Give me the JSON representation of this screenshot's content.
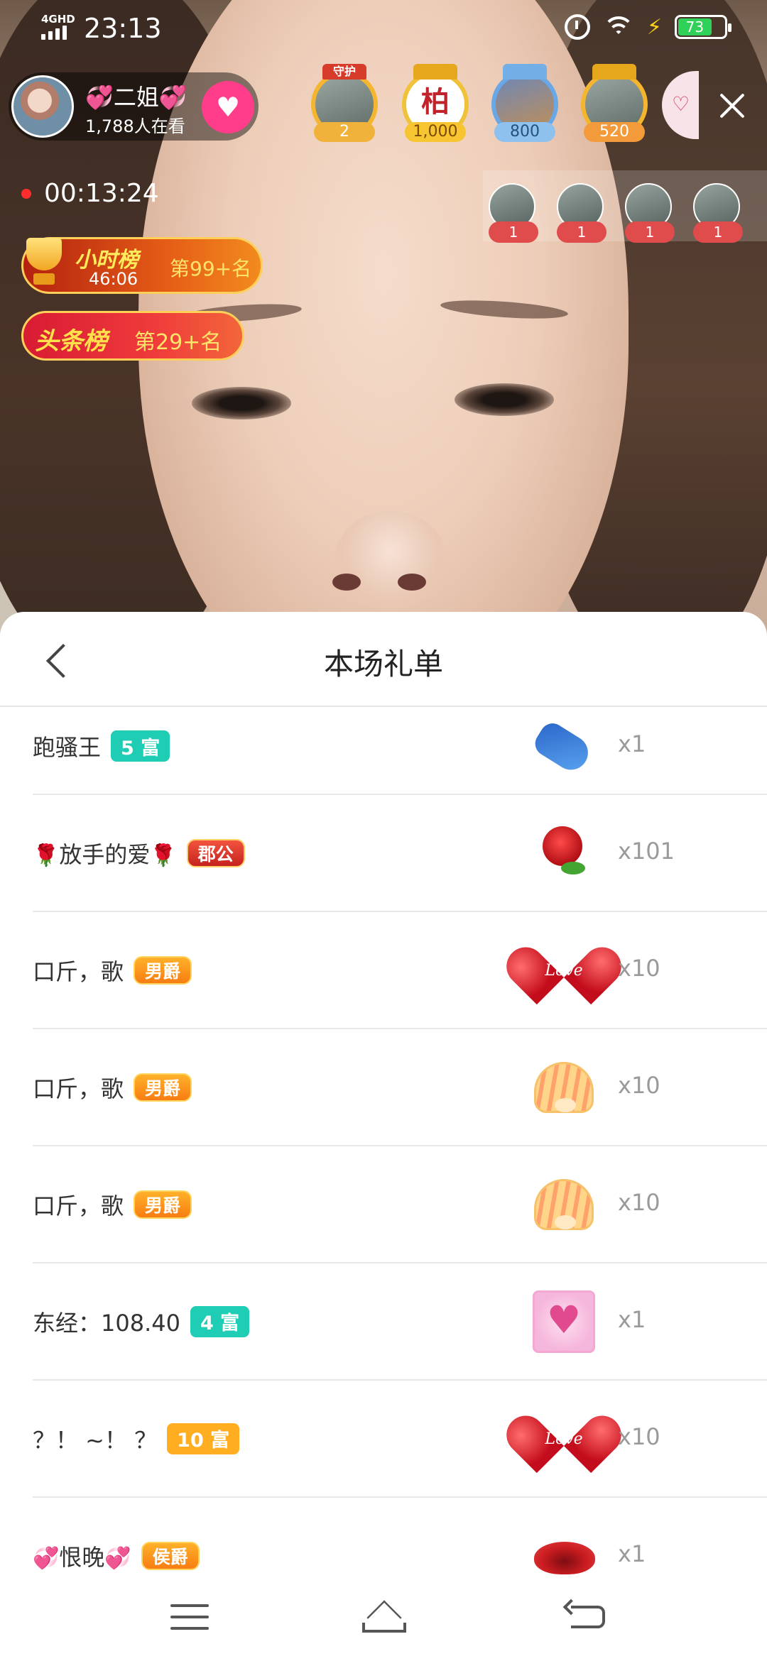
{
  "status_bar": {
    "network": "4GHD",
    "time": "23:13",
    "battery": "73"
  },
  "host": {
    "name": "💞二姐💞",
    "viewers": "1,788人在看"
  },
  "top_fans": [
    {
      "badge": "守护",
      "value": "2"
    },
    {
      "badge": "",
      "label": "柏",
      "value": "1,000"
    },
    {
      "badge": "",
      "value": "800"
    },
    {
      "badge": "",
      "value": "520"
    }
  ],
  "live_timer": "00:13:24",
  "audience": [
    {
      "count": "1"
    },
    {
      "count": "1"
    },
    {
      "count": "1"
    },
    {
      "count": "1"
    }
  ],
  "hour_rank": {
    "title": "小时榜",
    "countdown": "46:06",
    "position": "第99+名"
  },
  "headline_rank": {
    "title": "头条榜",
    "position": "第29+名"
  },
  "sheet": {
    "title": "本场礼单"
  },
  "gift_list": [
    {
      "user": "跑骚王",
      "badge": "5 富",
      "gift_icon": "blue-slipper",
      "count": "x1"
    },
    {
      "user": "放手的爱",
      "badge": "郡公",
      "gift_icon": "rose",
      "count": "x101"
    },
    {
      "user": "口斤，歌",
      "badge": "男爵",
      "gift_icon": "love-heart",
      "count": "x10"
    },
    {
      "user": "口斤，歌",
      "badge": "男爵",
      "gift_icon": "shell",
      "count": "x10"
    },
    {
      "user": "口斤，歌",
      "badge": "男爵",
      "gift_icon": "shell",
      "count": "x10"
    },
    {
      "user": "东经：108.40",
      "badge": "4 富",
      "gift_icon": "heart-box",
      "count": "x1"
    },
    {
      "user": "？！ ~！ ？",
      "badge": "10 富",
      "gift_icon": "love-heart",
      "count": "x10"
    },
    {
      "user": "恨晚",
      "badge": "侯爵",
      "gift_icon": "lips",
      "count": "x1"
    }
  ],
  "colors": {
    "rich_badge": "#1ecdb4",
    "rich_badge_high": "#ffad21",
    "noble_badge": "#f77d12",
    "live_dot": "#ff2e2e"
  }
}
